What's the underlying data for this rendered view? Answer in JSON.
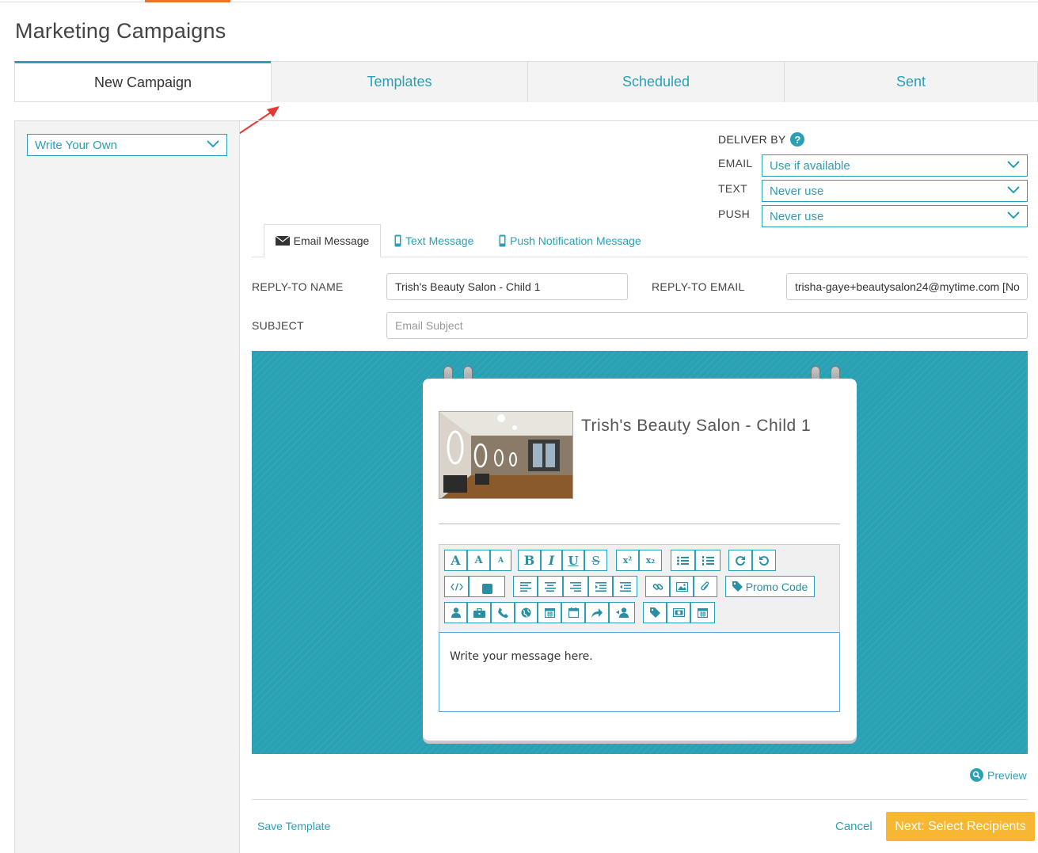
{
  "page": {
    "title": "Marketing Campaigns"
  },
  "tabs": [
    {
      "label": "New Campaign",
      "active": true
    },
    {
      "label": "Templates"
    },
    {
      "label": "Scheduled"
    },
    {
      "label": "Sent"
    }
  ],
  "sidebar": {
    "template_select": "Write Your Own"
  },
  "deliver": {
    "title": "DELIVER BY",
    "help_icon": "?",
    "email_label": "EMAIL",
    "email_value": "Use if available",
    "text_label": "TEXT",
    "text_value": "Never use",
    "push_label": "PUSH",
    "push_value": "Never use"
  },
  "message_tabs": {
    "email": "Email Message",
    "text": "Text Message",
    "push": "Push Notification Message"
  },
  "form": {
    "reply_to_name_label": "REPLY-TO NAME",
    "reply_to_name_value": "Trish's Beauty Salon - Child 1",
    "reply_to_email_label": "REPLY-TO EMAIL",
    "reply_to_email_value": "trisha-gaye+beautysalon24@mytime.com [No",
    "subject_label": "SUBJECT",
    "subject_placeholder": "Email Subject"
  },
  "card": {
    "business_name": "Trish's Beauty Salon - Child 1",
    "message_placeholder": "Write your message here."
  },
  "toolbar": {
    "font_large": "A",
    "font_medium": "A",
    "font_small": "A",
    "bold": "B",
    "italic": "I",
    "underline": "U",
    "strike": "S",
    "superscript": "x²",
    "subscript": "x₂",
    "promo_code": "Promo Code"
  },
  "footer": {
    "preview": "Preview",
    "save_template": "Save Template",
    "cancel": "Cancel",
    "next": "Next: Select Recipients"
  },
  "colors": {
    "accent": "#2aa0b5",
    "cta": "#f7b733",
    "top_accent": "#e8742b"
  }
}
